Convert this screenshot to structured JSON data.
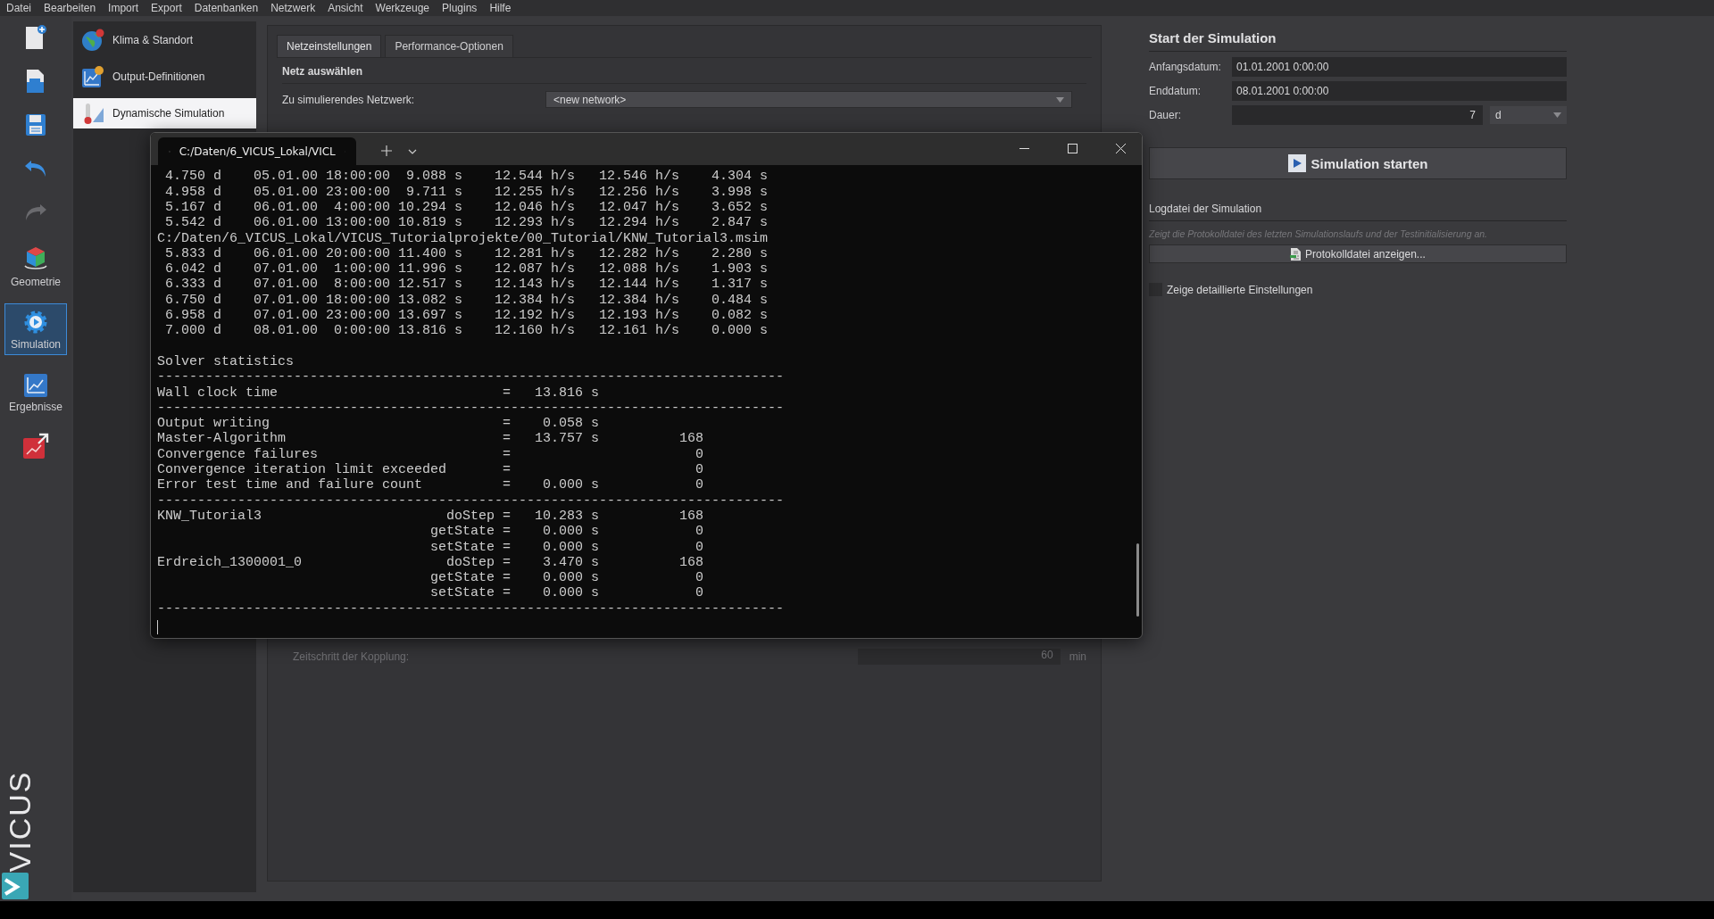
{
  "menu": [
    "Datei",
    "Bearbeiten",
    "Import",
    "Export",
    "Datenbanken",
    "Netzwerk",
    "Ansicht",
    "Werkzeuge",
    "Plugins",
    "Hilfe"
  ],
  "toolbar": [
    {
      "kind": "new",
      "selected": false
    },
    {
      "kind": "saveas",
      "selected": false
    },
    {
      "kind": "save",
      "selected": false
    },
    {
      "kind": "undo",
      "selected": false
    },
    {
      "kind": "redo",
      "selected": false
    },
    {
      "kind": "geometry",
      "label": "Geometrie",
      "selected": false
    },
    {
      "kind": "simulation",
      "label": "Simulation",
      "selected": true
    },
    {
      "kind": "results",
      "label": "Ergebnisse",
      "selected": false
    },
    {
      "kind": "export",
      "selected": false
    }
  ],
  "brand": "VICUS",
  "nav": [
    {
      "kind": "globe",
      "label": "Klima & Standort",
      "selected": false
    },
    {
      "kind": "chart",
      "label": "Output-Definitionen",
      "selected": false
    },
    {
      "kind": "thermo",
      "label": "Dynamische Simulation",
      "selected": true
    }
  ],
  "center": {
    "tabs": [
      {
        "label": "Netzeinstellungen",
        "selected": true
      },
      {
        "label": "Performance-Optionen",
        "selected": false
      }
    ],
    "heading": "Netz auswählen",
    "network_label": "Zu simulierendes Netzwerk:",
    "network_value": "<new network>",
    "coupling_label": "Zeitschritt der Kopplung:",
    "coupling_value": "60",
    "coupling_unit": "min"
  },
  "right": {
    "title": "Start der Simulation",
    "fields": [
      {
        "label": "Anfangsdatum:",
        "value": "01.01.2001  0:00:00"
      },
      {
        "label": "Enddatum:",
        "value": "08.01.2001  0:00:00"
      }
    ],
    "duration_label": "Dauer:",
    "duration_value": "7",
    "duration_unit": "d",
    "start_button": "Simulation starten",
    "log_title": "Logdatei der Simulation",
    "log_hint": "Zeigt die Protokolldatei des letzten Simulationslaufs und der Testinitialisierung an.",
    "log_button": "Protokolldatei anzeigen...",
    "details": {
      "label": "Zeige detaillierte Einstellungen",
      "checked": false
    }
  },
  "terminal": {
    "tab_title": "C:/Daten/6_VICUS_Lokal/VICL",
    "blocks": [
      {
        "lines": [
          " 4.750 d    05.01.00 18:00:00  9.088 s    12.544 h/s   12.546 h/s    4.304 s",
          " 4.958 d    05.01.00 23:00:00  9.711 s    12.255 h/s   12.256 h/s    3.998 s",
          " 5.167 d    06.01.00  4:00:00 10.294 s    12.046 h/s   12.047 h/s    3.652 s",
          " 5.542 d    06.01.00 13:00:00 10.819 s    12.293 h/s   12.294 h/s    2.847 s",
          "C:/Daten/6_VICUS_Lokal/VICUS_Tutorialprojekte/00_Tutorial/KNW_Tutorial3.msim",
          " 5.833 d    06.01.00 20:00:00 11.400 s    12.281 h/s   12.282 h/s    2.280 s",
          " 6.042 d    07.01.00  1:00:00 11.996 s    12.087 h/s   12.088 h/s    1.903 s",
          " 6.333 d    07.01.00  8:00:00 12.517 s    12.143 h/s   12.144 h/s    1.317 s",
          " 6.750 d    07.01.00 18:00:00 13.082 s    12.384 h/s   12.384 h/s    0.484 s",
          " 6.958 d    07.01.00 23:00:00 13.697 s    12.192 h/s   12.193 h/s    0.082 s",
          " 7.000 d    08.01.00  0:00:00 13.816 s    12.160 h/s   12.161 h/s    0.000 s"
        ]
      },
      {
        "lines": [
          "Solver statistics",
          "------------------------------------------------------------------------------",
          "Wall clock time                            =   13.816 s",
          "------------------------------------------------------------------------------",
          "Output writing                             =    0.058 s",
          "Master-Algorithm                           =   13.757 s          168",
          "Convergence failures                       =                       0",
          "Convergence iteration limit exceeded       =                       0",
          "Error test time and failure count          =    0.000 s            0",
          "------------------------------------------------------------------------------",
          "KNW_Tutorial3                       doStep =   10.283 s          168",
          "                                  getState =    0.000 s            0",
          "                                  setState =    0.000 s            0",
          "Erdreich_1300001_0                  doStep =    3.470 s          168",
          "                                  getState =    0.000 s            0",
          "                                  setState =    0.000 s            0",
          "------------------------------------------------------------------------------"
        ]
      }
    ]
  }
}
